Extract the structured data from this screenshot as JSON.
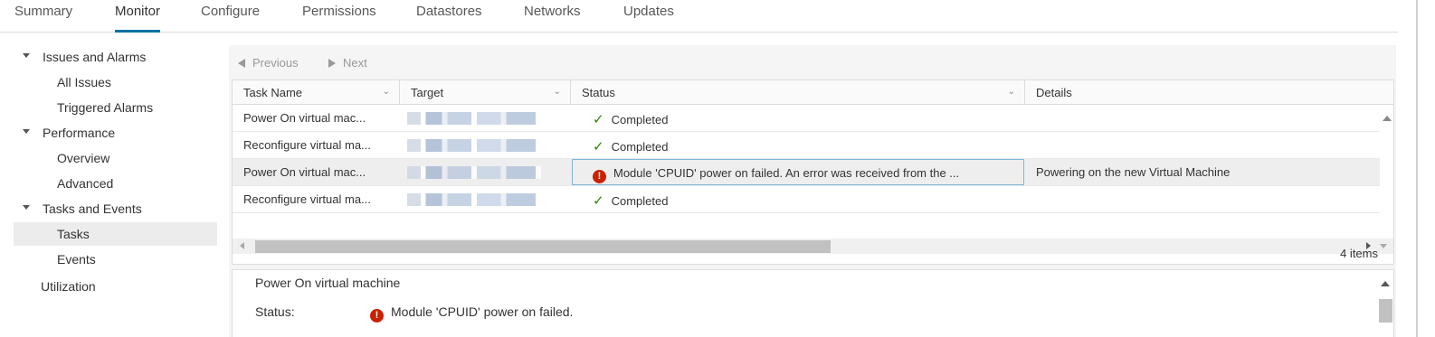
{
  "tabs": [
    {
      "label": "Summary"
    },
    {
      "label": "Monitor"
    },
    {
      "label": "Configure"
    },
    {
      "label": "Permissions"
    },
    {
      "label": "Datastores"
    },
    {
      "label": "Networks"
    },
    {
      "label": "Updates"
    }
  ],
  "nav": {
    "items": [
      {
        "label": "Issues and Alarms"
      },
      {
        "label": "All Issues"
      },
      {
        "label": "Triggered Alarms"
      },
      {
        "label": "Performance"
      },
      {
        "label": "Overview"
      },
      {
        "label": "Advanced"
      },
      {
        "label": "Tasks and Events"
      },
      {
        "label": "Tasks"
      },
      {
        "label": "Events"
      },
      {
        "label": "Utilization"
      }
    ]
  },
  "toolbar": {
    "previous_label": "Previous",
    "next_label": "Next"
  },
  "grid": {
    "columns": [
      {
        "label": "Task Name"
      },
      {
        "label": "Target"
      },
      {
        "label": "Status"
      },
      {
        "label": "Details"
      }
    ],
    "rows": [
      {
        "task": "Power On virtual mac...",
        "status": "Completed",
        "details": ""
      },
      {
        "task": "Reconfigure virtual ma...",
        "status": "Completed",
        "details": ""
      },
      {
        "task": "Power On virtual mac...",
        "status": "Module 'CPUID' power on failed. An error was received from the ...",
        "details": "Powering on the new Virtual Machine"
      },
      {
        "task": "Reconfigure virtual ma...",
        "status": "Completed",
        "details": ""
      }
    ],
    "items_count": "4 items"
  },
  "detail": {
    "title": "Power On virtual machine",
    "status_label": "Status:",
    "status_value": "Module 'CPUID' power on failed."
  },
  "colors": {
    "accent": "#0072a3",
    "success": "#2f8400",
    "error": "#c92100"
  }
}
